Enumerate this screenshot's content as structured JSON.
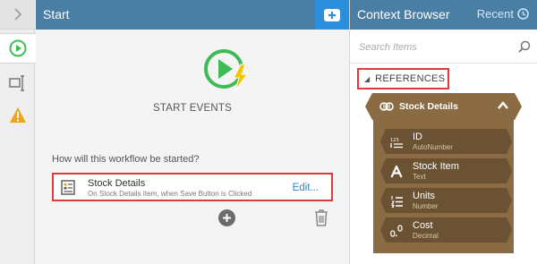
{
  "center": {
    "title": "Start",
    "start_label": "START EVENTS",
    "question": "How will this workflow be started?",
    "trigger": {
      "title": "Stock Details",
      "subtitle": "On Stock Details Item, when Save Button is Clicked",
      "edit_label": "Edit..."
    }
  },
  "right": {
    "title": "Context Browser",
    "recent_label": "Recent",
    "search_placeholder": "Search Items",
    "references_label": "REFERENCES",
    "group": {
      "name": "Stock Details",
      "fields": [
        {
          "name": "ID",
          "type": "AutoNumber",
          "icon": "autonumber-icon"
        },
        {
          "name": "Stock Item",
          "type": "Text",
          "icon": "text-icon"
        },
        {
          "name": "Units",
          "type": "Number",
          "icon": "number-icon"
        },
        {
          "name": "Cost",
          "type": "Decimal",
          "icon": "decimal-icon"
        }
      ]
    }
  },
  "colors": {
    "header": "#4a7fa3",
    "accent_blue": "#2d8fdc",
    "start_green": "#3dbb57",
    "bolt_yellow": "#f5c400",
    "highlight_red": "#e03a3a",
    "reference_brown": "#8a6b43"
  }
}
